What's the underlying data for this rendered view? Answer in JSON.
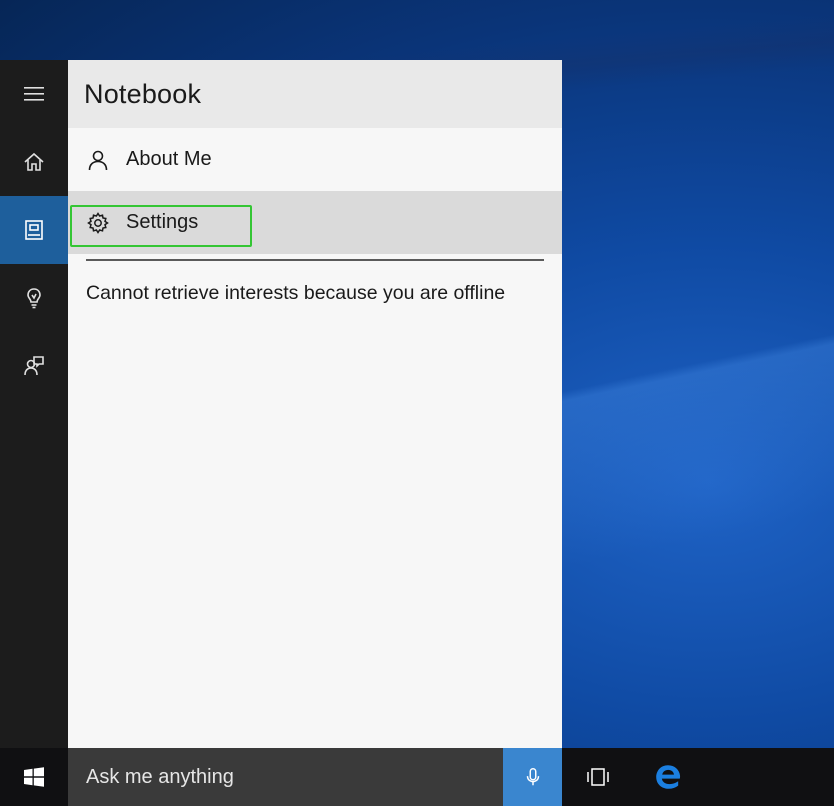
{
  "panel": {
    "title": "Notebook",
    "items": [
      {
        "label": "About Me",
        "icon": "person-icon"
      },
      {
        "label": "Settings",
        "icon": "gear-icon",
        "selected": true
      }
    ],
    "message": "Cannot retrieve interests because you are offline"
  },
  "rail": {
    "items": [
      "hamburger-icon",
      "home-icon",
      "notebook-icon",
      "lightbulb-icon",
      "feedback-icon"
    ],
    "active": "notebook-icon",
    "active_color": "#1e5f9c"
  },
  "taskbar": {
    "search_placeholder": "Ask me anything",
    "mic_color": "#3a86cf",
    "icons": [
      "windows-start-icon",
      "microphone-icon",
      "task-view-icon",
      "edge-icon"
    ]
  },
  "highlight_color": "#34c634"
}
